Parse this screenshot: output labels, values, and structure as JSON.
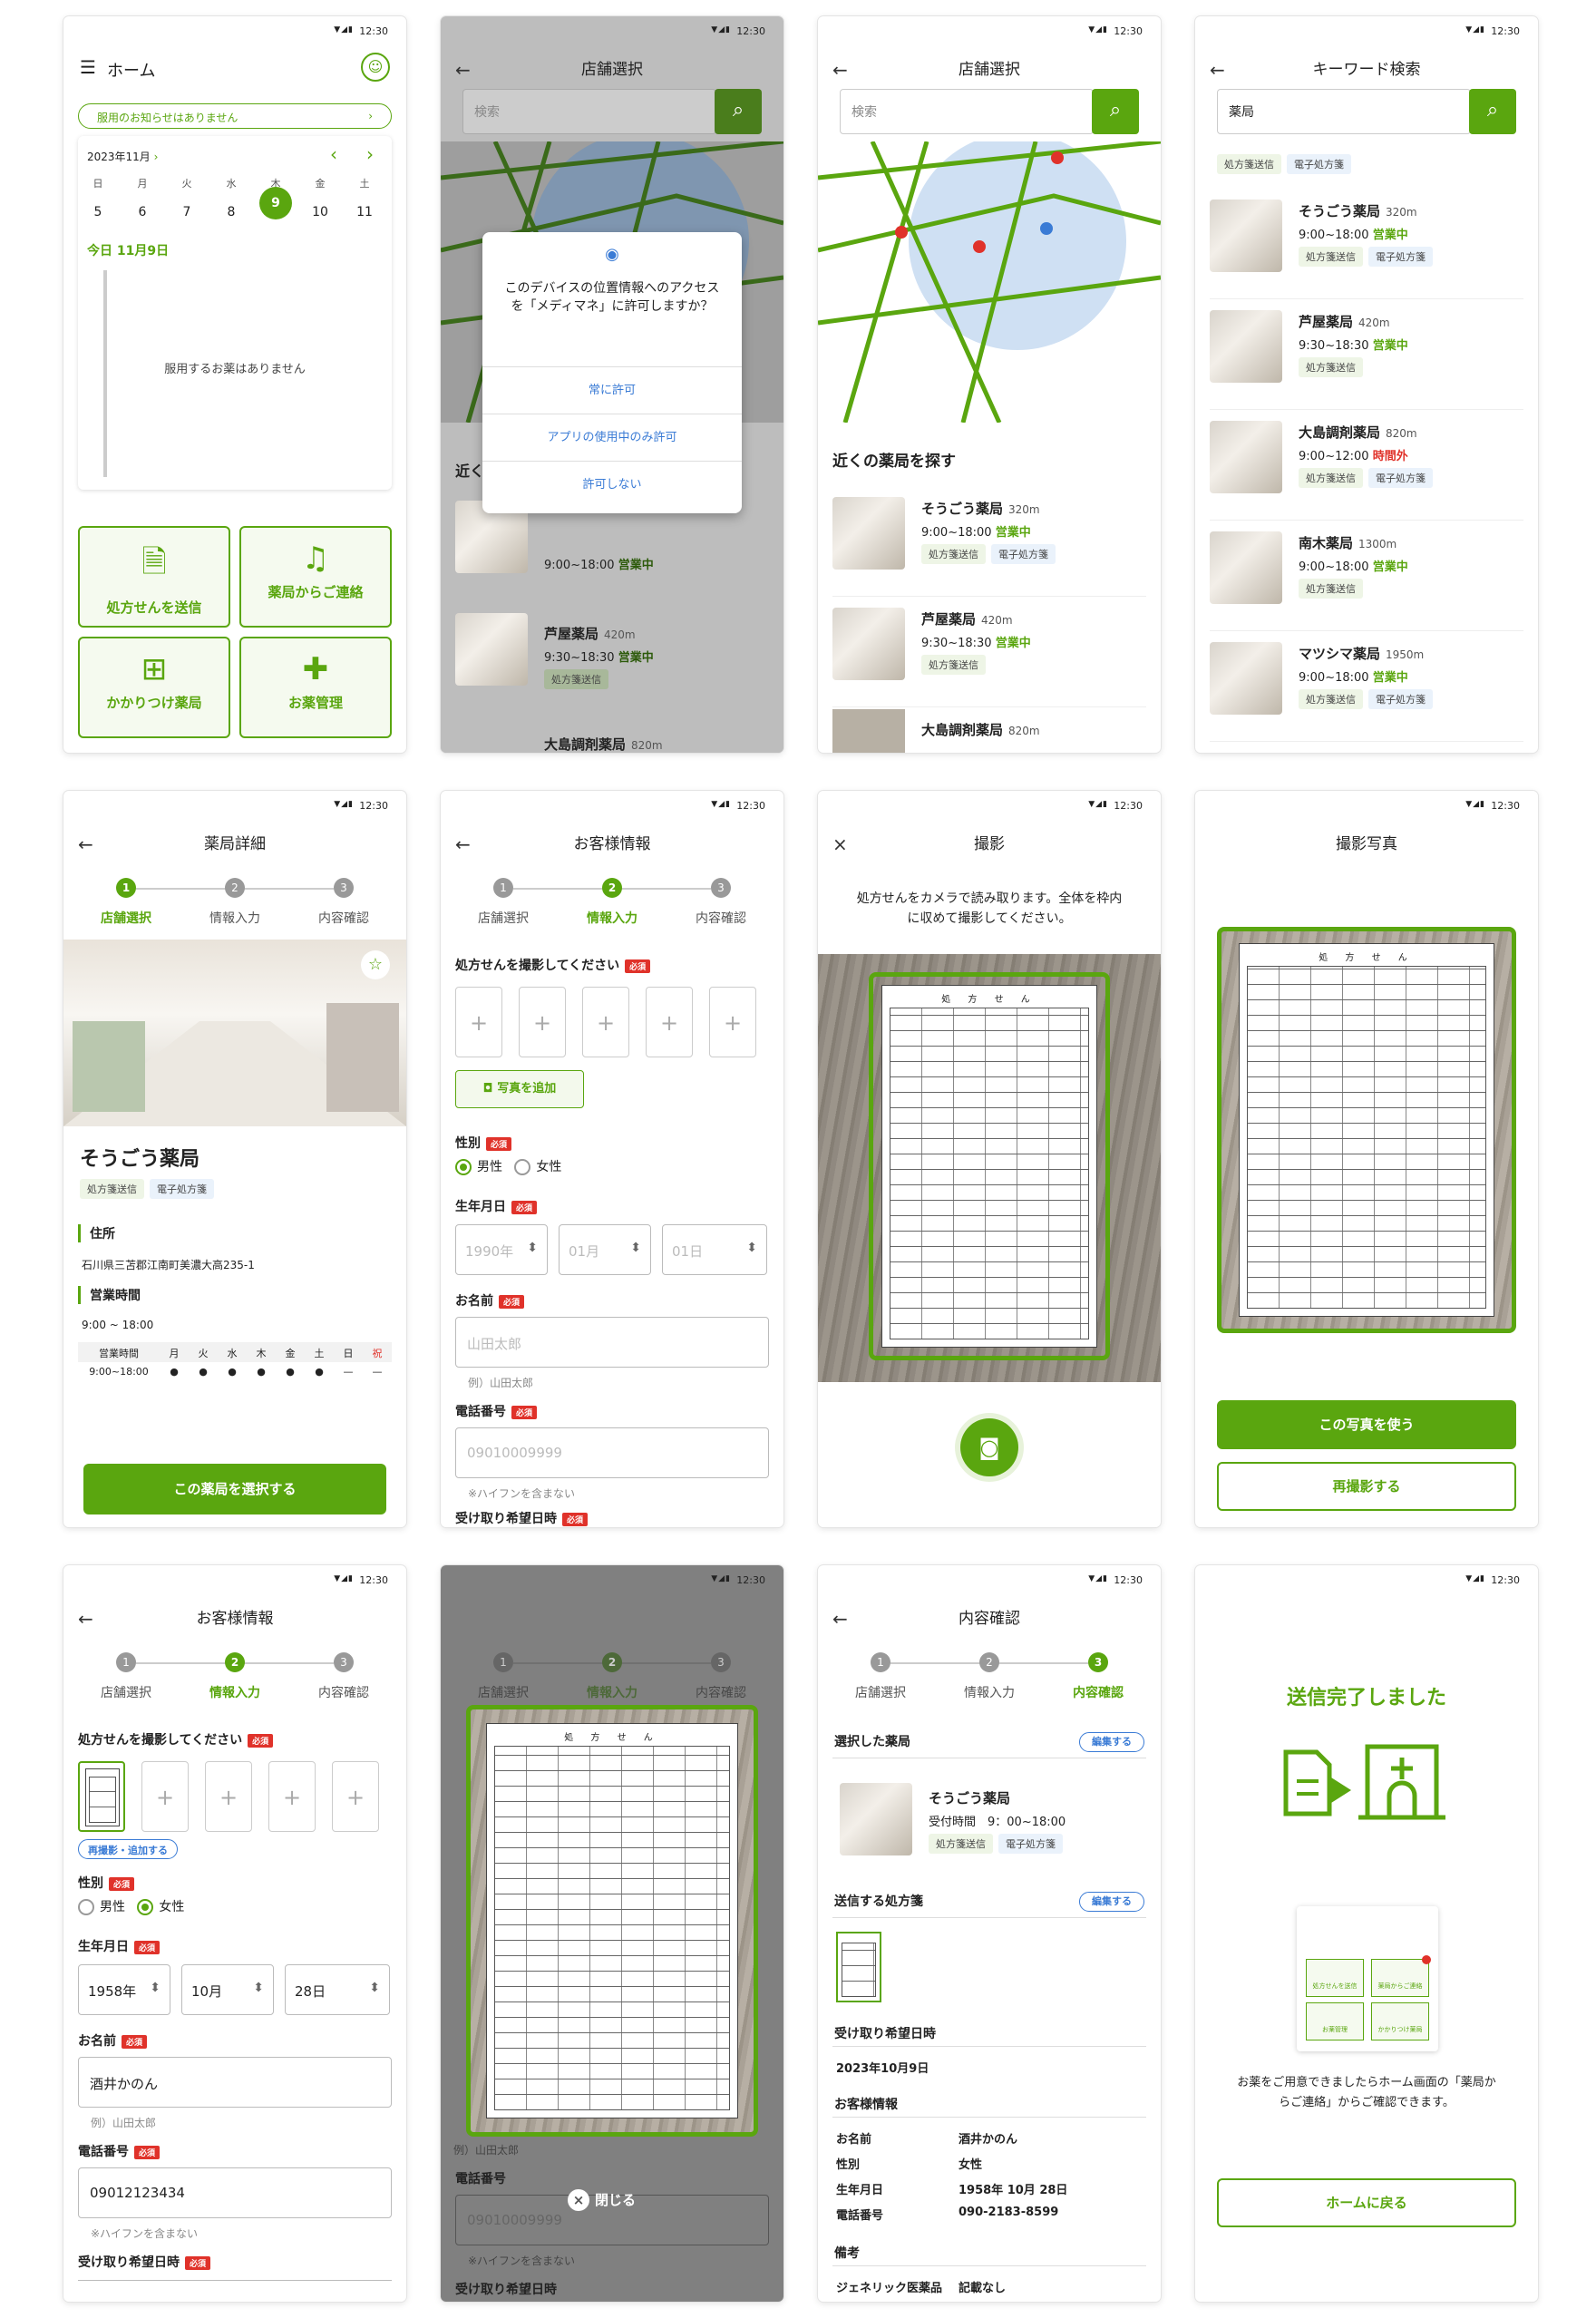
{
  "status": {
    "time": "12:30",
    "icons": "▼◢▮"
  },
  "home": {
    "title": "ホーム",
    "notice": "服用のお知らせはありません",
    "month": "2023年11月",
    "weekdays": [
      "日",
      "月",
      "火",
      "水",
      "木",
      "金",
      "土"
    ],
    "days": [
      "5",
      "6",
      "7",
      "8",
      "9",
      "10",
      "11"
    ],
    "today_label": "今日 11月9日",
    "empty": "服用するお薬はありません",
    "tiles": [
      "処方せんを送信",
      "薬局からご連絡",
      "かかりつけ薬局",
      "お薬管理"
    ]
  },
  "store": {
    "title": "店舗選択",
    "search_placeholder": "検索",
    "perm_text": "このデバイスの位置情報へのアクセスを「メディマネ」に許可しますか？",
    "perm_always": "常に許可",
    "perm_while": "アプリの使用中のみ許可",
    "perm_deny": "許可しない",
    "near_title": "近くの薬局を探す",
    "near_title_short": "近く"
  },
  "keyword": {
    "title": "キーワード検索",
    "query": "薬局",
    "filters": [
      "処方箋送信",
      "電子処方箋"
    ]
  },
  "shops": [
    {
      "name": "そうごう薬局",
      "dist": "320m",
      "hours": "9:00~18:00",
      "status": "営業中",
      "tags": [
        "処方箋送信",
        "電子処方箋"
      ]
    },
    {
      "name": "芦屋薬局",
      "dist": "420m",
      "hours": "9:30~18:30",
      "status": "営業中",
      "tags": [
        "処方箋送信"
      ]
    },
    {
      "name": "大島調剤薬局",
      "dist": "820m",
      "hours": "9:00~12:00",
      "status": "時間外",
      "tags": [
        "処方箋送信",
        "電子処方箋"
      ]
    },
    {
      "name": "南木薬局",
      "dist": "1300m",
      "hours": "9:00~18:00",
      "status": "営業中",
      "tags": [
        "処方箋送信"
      ]
    },
    {
      "name": "マツシマ薬局",
      "dist": "1950m",
      "hours": "9:00~18:00",
      "status": "営業中",
      "tags": [
        "処方箋送信",
        "電子処方箋"
      ]
    }
  ],
  "steps": [
    "店舗選択",
    "情報入力",
    "内容確認"
  ],
  "detail": {
    "title": "薬局詳細",
    "name": "そうごう薬局",
    "addr_label": "住所",
    "addr": "石川県三苫郡江南町美濃大高235-1",
    "hours_label": "営業時間",
    "hours": "9:00 ~ 18:00",
    "table_head": [
      "営業時間",
      "月",
      "火",
      "水",
      "木",
      "金",
      "土",
      "日",
      "祝"
    ],
    "table_row": [
      "9:00~18:00",
      "●",
      "●",
      "●",
      "●",
      "●",
      "●",
      "—",
      "—"
    ],
    "select_btn": "この薬局を選択する"
  },
  "form": {
    "title": "お客様情報",
    "rx_label": "処方せんを撮影してください",
    "required": "必須",
    "add_photo": "写真を追加",
    "retake_add": "再撮影・追加する",
    "gender_label": "性別",
    "male": "男性",
    "female": "女性",
    "dob_label": "生年月日",
    "dob_ph": [
      "1990年",
      "01月",
      "01日"
    ],
    "dob_val": [
      "1958年",
      "10月",
      "28日"
    ],
    "name_label": "お名前",
    "name_ph": "山田太郎",
    "name_val": "酒井かのん",
    "name_hint": "例）山田太郎",
    "phone_label": "電話番号",
    "phone_ph": "09010009999",
    "phone_val": "09012123434",
    "phone_hint": "※ハイフンを含まない",
    "pickup_label": "受け取り希望日時",
    "close": "閉じる"
  },
  "camera": {
    "title": "撮影",
    "instr": "処方せんをカメラで読み取ります。全体を枠内に収めて撮影してください。",
    "rx_title": "処 方 せ ん"
  },
  "photo": {
    "title": "撮影写真",
    "use": "この写真を使う",
    "retake": "再撮影する"
  },
  "confirm": {
    "title": "内容確認",
    "sel_shop": "選択した薬局",
    "edit": "編集する",
    "shop": "そうごう薬局",
    "reception": "受付時間　9：00~18:00",
    "rx_send": "送信する処方箋",
    "pickup_label": "受け取り希望日時",
    "pickup": "2023年10月9日",
    "cust_label": "お客様情報",
    "rows": [
      [
        "お名前",
        "酒井かのん"
      ],
      [
        "性別",
        "女性"
      ],
      [
        "生年月日",
        "1958年 10月 28日"
      ],
      [
        "電話番号",
        "090-2183-8599"
      ]
    ],
    "note_label": "備考",
    "generic_label": "ジェネリック医薬品",
    "generic_val": "記載なし"
  },
  "done": {
    "title": "送信完了しました",
    "msg": "お薬をご用意できましたらホーム画面の「薬局からご連絡」からご確認できます。",
    "home_btn": "ホームに戻る",
    "mini_tiles": [
      "処方せんを送信",
      "薬局からご連絡",
      "お薬管理",
      "かかりつけ薬局"
    ]
  },
  "colors": {
    "accent": "#5aa60f",
    "danger": "#e0322a",
    "link": "#3a7bd5"
  }
}
